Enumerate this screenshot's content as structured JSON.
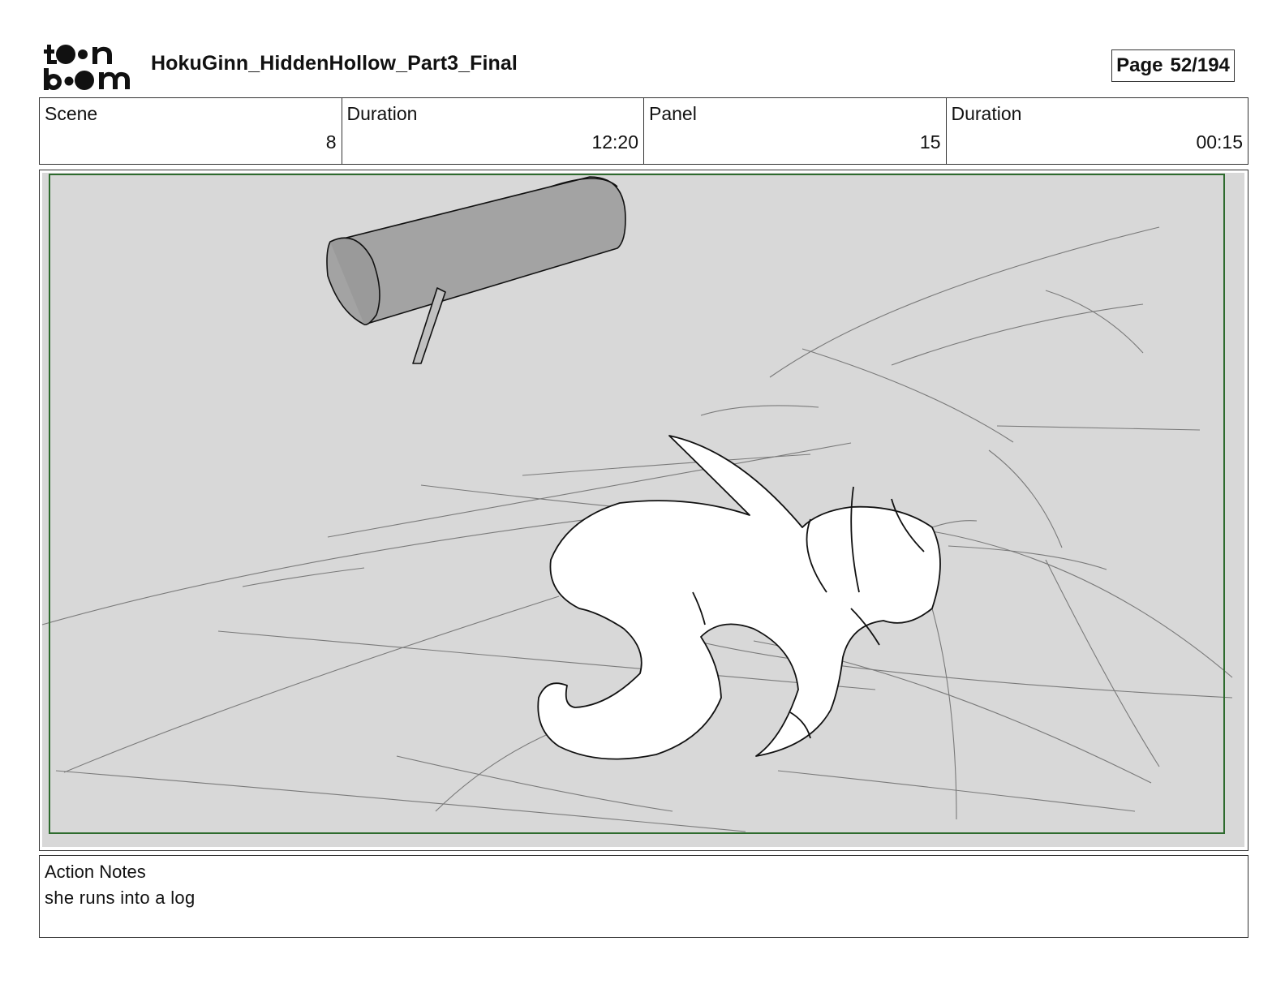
{
  "header": {
    "logo_text": "toon boom",
    "project_title": "HokuGinn_HiddenHollow_Part3_Final",
    "page_label": "Page",
    "page_value": "52/194"
  },
  "info": {
    "scene_label": "Scene",
    "scene_value": "8",
    "scene_duration_label": "Duration",
    "scene_duration_value": "12:20",
    "panel_label": "Panel",
    "panel_value": "15",
    "panel_duration_label": "Duration",
    "panel_duration_value": "00:15"
  },
  "notes": {
    "label": "Action Notes",
    "text": "she runs into a log"
  },
  "colors": {
    "safe_frame": "#2e6b2e",
    "panel_background": "#d8d8d8",
    "log_fill": "#a3a3a3"
  }
}
